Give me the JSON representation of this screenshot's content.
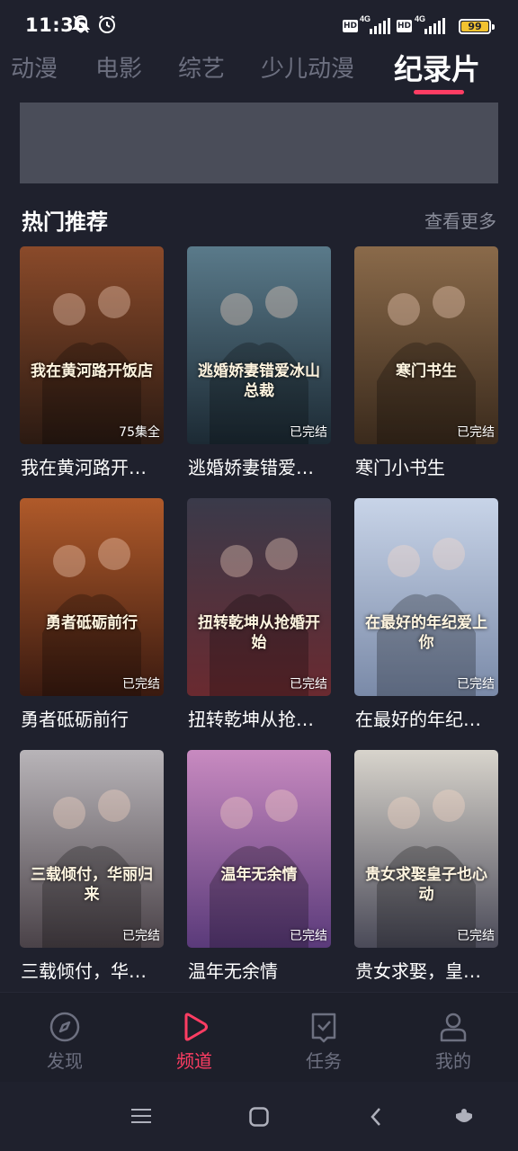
{
  "status": {
    "time": "11:36",
    "network1": "4G",
    "network2": "4G",
    "hd": "HD",
    "battery": "99"
  },
  "tabs": [
    {
      "label": "动漫",
      "active": false
    },
    {
      "label": "电影",
      "active": false
    },
    {
      "label": "综艺",
      "active": false
    },
    {
      "label": "少儿动漫",
      "active": false
    },
    {
      "label": "纪录片",
      "active": true
    }
  ],
  "section": {
    "title": "热门推荐",
    "more": "查看更多"
  },
  "cards": [
    {
      "title": "我在黄河路开…",
      "badge": "75集全",
      "poster_text": "我在黄河路开饭店",
      "color1": "#8a4a2a",
      "color2": "#2b1a12"
    },
    {
      "title": "逃婚娇妻错爱…",
      "badge": "已完结",
      "poster_text": "逃婚娇妻错爱冰山总裁",
      "color1": "#5a7a8a",
      "color2": "#1c2a34"
    },
    {
      "title": "寒门小书生",
      "badge": "已完结",
      "poster_text": "寒门书生",
      "color1": "#8a6a4a",
      "color2": "#3a2a1c"
    },
    {
      "title": "勇者砥砺前行",
      "badge": "已完结",
      "poster_text": "勇者砥砺前行",
      "color1": "#b05a2a",
      "color2": "#3a1a10"
    },
    {
      "title": "扭转乾坤从抢…",
      "badge": "已完结",
      "poster_text": "扭转乾坤从抢婚开始",
      "color1": "#3a3a4a",
      "color2": "#6a2a30"
    },
    {
      "title": "在最好的年纪…",
      "badge": "已完结",
      "poster_text": "在最好的年纪爱上你",
      "color1": "#c8d4e8",
      "color2": "#7a8aa8"
    },
    {
      "title": "三载倾付，华…",
      "badge": "已完结",
      "poster_text": "三载倾付，华丽归来",
      "color1": "#b8b4b8",
      "color2": "#4a4248"
    },
    {
      "title": "温年无余情",
      "badge": "已完结",
      "poster_text": "温年无余情",
      "color1": "#c88ac0",
      "color2": "#5a3a7a"
    },
    {
      "title": "贵女求娶，皇…",
      "badge": "已完结",
      "poster_text": "贵女求娶皇子也心动",
      "color1": "#d8d4cc",
      "color2": "#4a4a58"
    }
  ],
  "bottom_nav": [
    {
      "label": "发现",
      "icon": "compass-icon",
      "active": false
    },
    {
      "label": "频道",
      "icon": "play-icon",
      "active": true
    },
    {
      "label": "任务",
      "icon": "task-icon",
      "active": false
    },
    {
      "label": "我的",
      "icon": "user-icon",
      "active": false
    }
  ],
  "colors": {
    "accent": "#ff3d63",
    "background": "#1f212d",
    "muted": "#6d7080"
  }
}
